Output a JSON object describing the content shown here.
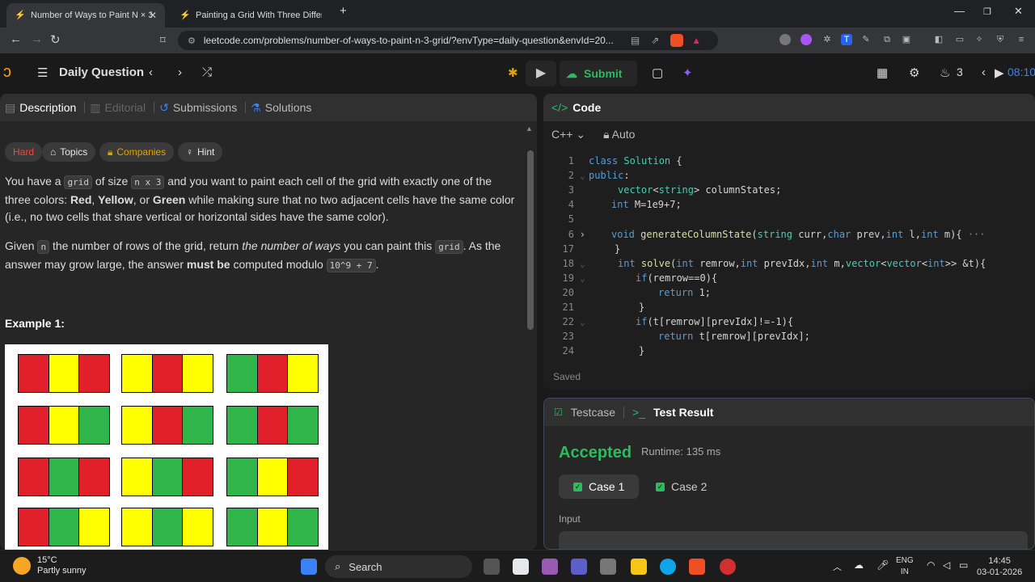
{
  "browser": {
    "tabs": [
      {
        "title": "Number of Ways to Paint N × 3 ("
      },
      {
        "title": "Painting a Grid With Three Different ("
      }
    ],
    "new_tab": "+",
    "url": "leetcode.com/problems/number-of-ways-to-paint-n-3-grid/?envType=daily-question&envId=20..."
  },
  "lc_header": {
    "title": "Daily Question",
    "submit_label": "Submit",
    "streak": "3",
    "timer": "08:10"
  },
  "left_tabs": [
    {
      "label": "Description"
    },
    {
      "label": "Editorial"
    },
    {
      "label": "Submissions"
    },
    {
      "label": "Solutions"
    }
  ],
  "badges": {
    "difficulty": "Hard",
    "topics": "Topics",
    "companies": "Companies",
    "hint": "Hint"
  },
  "description": {
    "p1_a": "You have a ",
    "p1_code1": "grid",
    "p1_b": " of size ",
    "p1_code2": "n x 3",
    "p1_c": " and you want to paint each cell of the grid with exactly one of the three colors: ",
    "red": "Red",
    "comma1": ", ",
    "yellow": "Yellow",
    "or": ", or ",
    "green": "Green",
    "p1_d": " while making sure that no two adjacent cells have the same color (i.e., no two cells that share vertical or horizontal sides have the same color).",
    "p2_a": "Given ",
    "p2_code1": "n",
    "p2_b": " the number of rows of the grid, return ",
    "p2_em": "the number of ways",
    "p2_c": " you can paint this ",
    "p2_code2": "grid",
    "p2_d": ". As the answer may grow large, the answer ",
    "p2_strong": "must be",
    "p2_e": " computed modulo ",
    "p2_mod": "10^9 + 7",
    "p2_f": ".",
    "example": "Example 1:"
  },
  "example_grids": [
    [
      "R",
      "Y",
      "R"
    ],
    [
      "Y",
      "R",
      "Y"
    ],
    [
      "G",
      "R",
      "Y"
    ],
    [
      "R",
      "Y",
      "G"
    ],
    [
      "Y",
      "R",
      "G"
    ],
    [
      "G",
      "R",
      "G"
    ],
    [
      "R",
      "G",
      "R"
    ],
    [
      "Y",
      "G",
      "R"
    ],
    [
      "G",
      "Y",
      "R"
    ],
    [
      "R",
      "G",
      "Y"
    ],
    [
      "Y",
      "G",
      "Y"
    ],
    [
      "G",
      "Y",
      "G"
    ]
  ],
  "colors": {
    "R": "#e2202c",
    "Y": "#ffff00",
    "G": "#2fb54a",
    "accent_green": "#2cbb5d",
    "hard": "#ef4743",
    "companies": "#e3a008"
  },
  "code_panel": {
    "title": "Code",
    "language": "C++",
    "mode": "Auto",
    "lines": [
      {
        "n": "1",
        "text": "class Solution {"
      },
      {
        "n": "2",
        "text": "public:"
      },
      {
        "n": "3",
        "text": "vector<string> columnStates;"
      },
      {
        "n": "4",
        "text": "int M=1e9+7;"
      },
      {
        "n": "5",
        "text": ""
      },
      {
        "n": "6",
        "text": "void generateColumnState(string curr,char prev,int l,int m){"
      },
      {
        "n": "17",
        "text": "}"
      },
      {
        "n": "18",
        "text": "int solve(int remrow,int prevIdx,int m,vector<vector<int>> &t){"
      },
      {
        "n": "19",
        "text": "if(remrow==0){"
      },
      {
        "n": "20",
        "text": "return 1;"
      },
      {
        "n": "21",
        "text": "}"
      },
      {
        "n": "22",
        "text": "if(t[remrow][prevIdx]!=-1){"
      },
      {
        "n": "23",
        "text": "return t[remrow][prevIdx];"
      },
      {
        "n": "24",
        "text": "}"
      }
    ],
    "fold_ellipsis": "···",
    "status": "Saved"
  },
  "test_panel": {
    "tab1": "Testcase",
    "tab2": "Test Result",
    "result": "Accepted",
    "runtime": "Runtime: 135 ms",
    "case1": "Case 1",
    "case2": "Case 2",
    "input_label": "Input"
  },
  "taskbar": {
    "temp": "15°C",
    "weather": "Partly sunny",
    "search": "Search",
    "lang1": "ENG",
    "lang2": "IN",
    "time": "14:45",
    "date": "03-01-2026"
  }
}
